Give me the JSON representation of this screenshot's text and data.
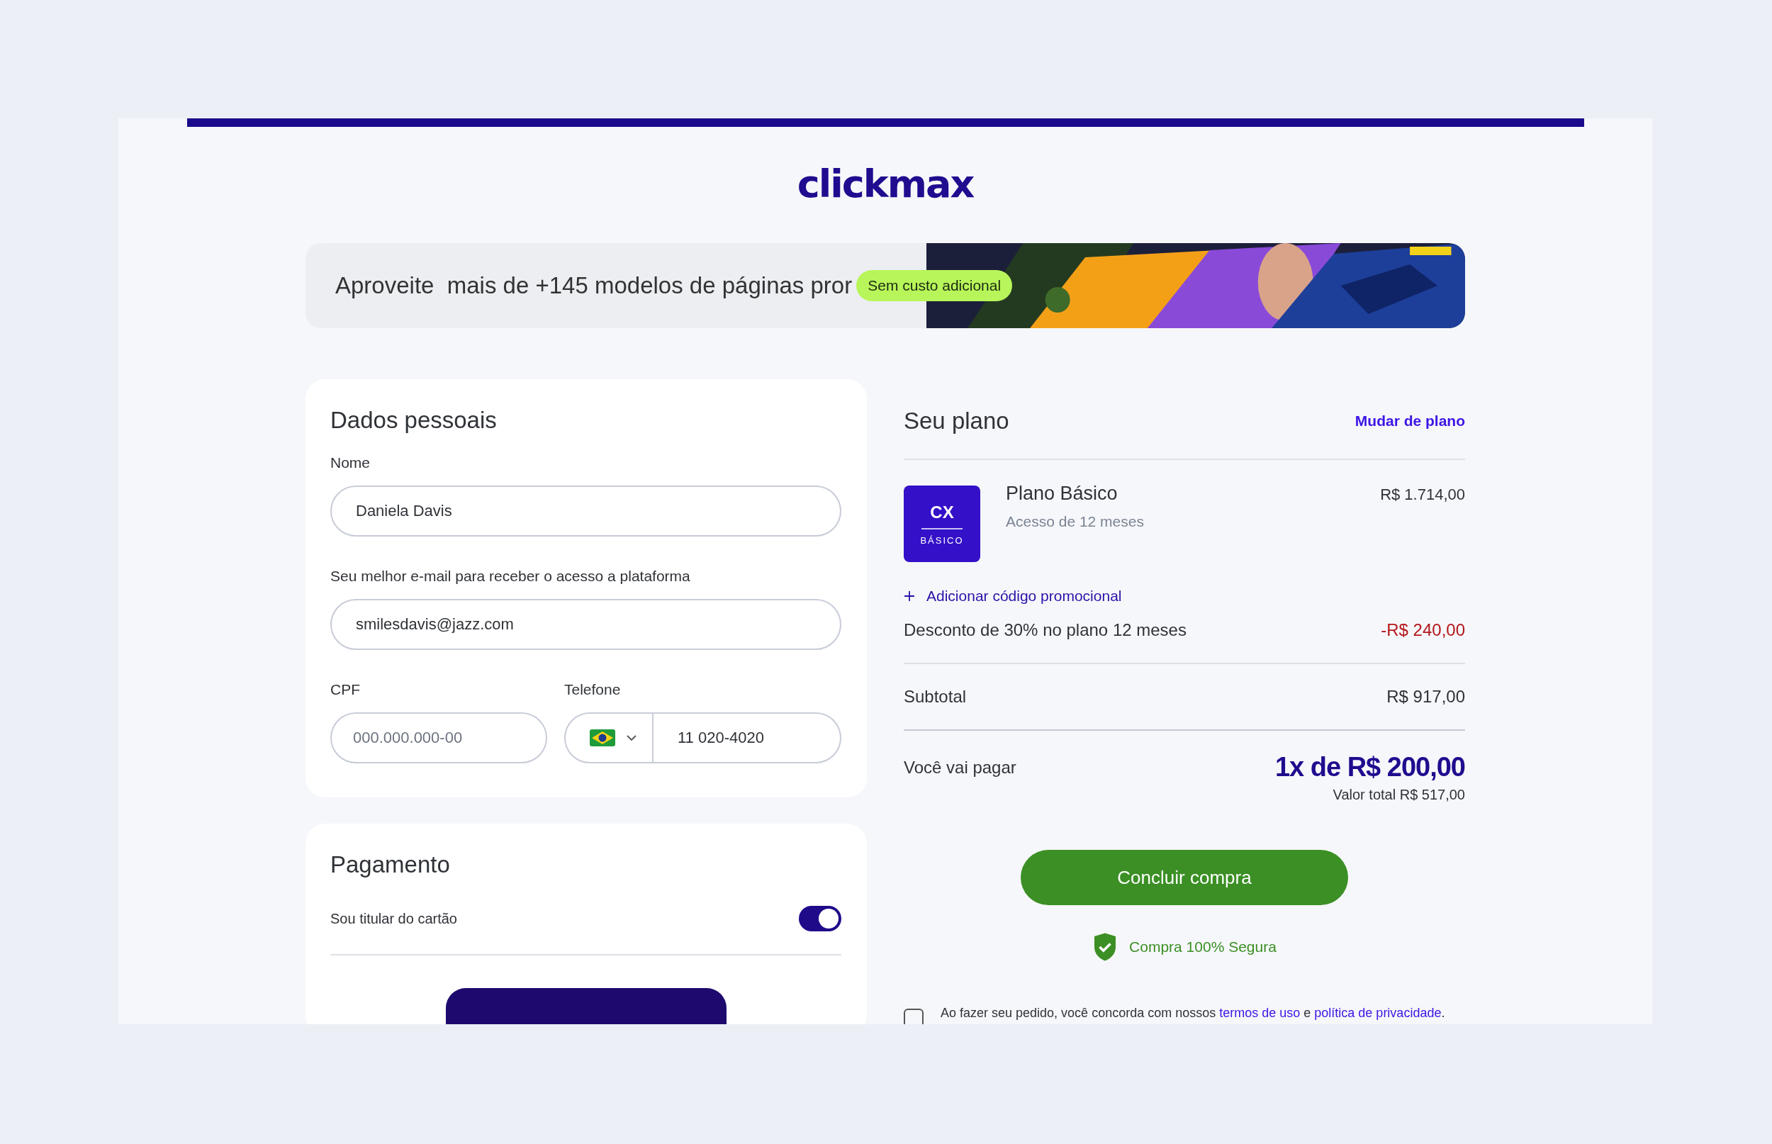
{
  "logo": "clickmax",
  "banner": {
    "text": "Aproveite  mais de +145 modelos de páginas pror",
    "badge": "Sem custo adicional"
  },
  "personal": {
    "title": "Dados pessoais",
    "fields": [
      {
        "label": "Nome",
        "value": "Daniela Davis"
      },
      {
        "label": "Seu melhor e-mail para receber o acesso a plataforma",
        "value": "smilesdavis@jazz.com"
      }
    ],
    "cpf": {
      "label": "CPF",
      "placeholder": "000.000.000-00"
    },
    "phone": {
      "label": "Telefone",
      "value": "11 020-4020"
    }
  },
  "payment": {
    "title": "Pagamento",
    "holder_label": "Sou titular do cartão",
    "holder_on": true
  },
  "plan": {
    "title": "Seu plano",
    "change_link": "Mudar de plano",
    "badge_top": "CX",
    "badge_bottom": "BÁSICO",
    "name": "Plano Básico",
    "duration": "Acesso de 12 meses",
    "price": "R$ 1.714,00",
    "promo_link": "Adicionar código promocional",
    "discount_label": "Desconto de 30% no plano 12 meses",
    "discount_value": "-R$ 240,00",
    "subtotal_label": "Subtotal",
    "subtotal_value": "R$ 917,00",
    "pay_label": "Você vai pagar",
    "pay_value": "1x de R$ 200,00",
    "total": "Valor total R$ 517,00",
    "submit": "Concluir compra",
    "secure": "Compra 100% Segura",
    "terms": {
      "checked": false,
      "before": "Ao fazer seu pedido, você concorda com nossos ",
      "link1": "termos de uso",
      "middle": " e ",
      "link2": "política de privacidade",
      "after": "."
    }
  }
}
